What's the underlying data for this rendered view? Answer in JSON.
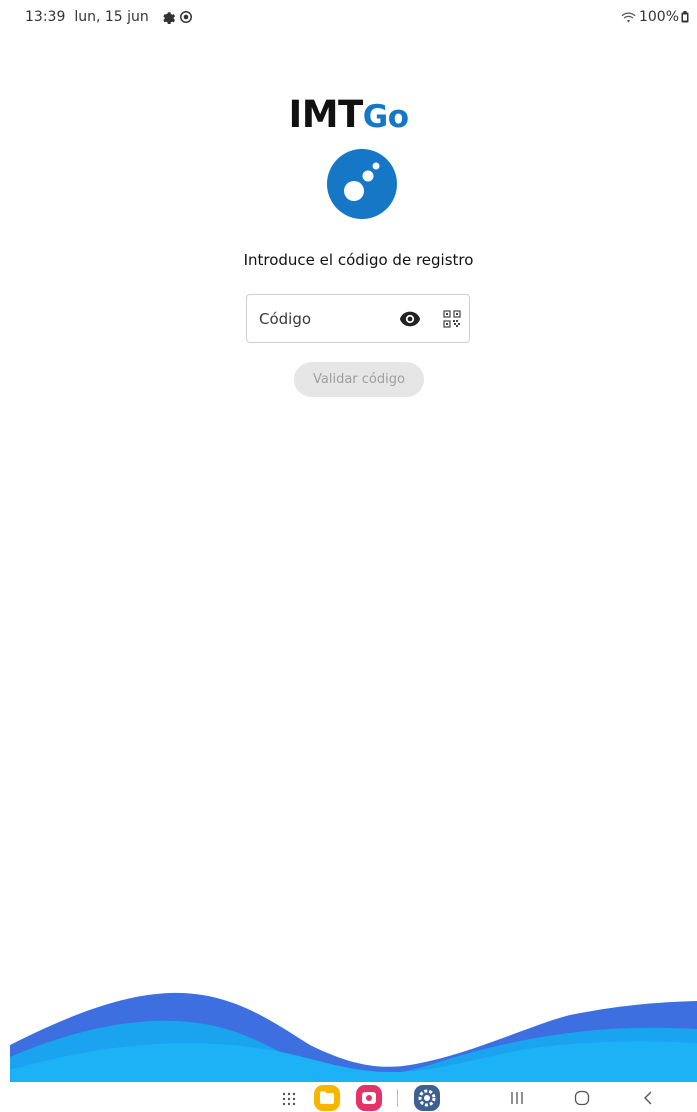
{
  "status_bar": {
    "time": "13:39",
    "date": "lun, 15 jun",
    "battery": "100%",
    "icons": [
      "settings-gear-icon",
      "location-target-icon",
      "wifi-icon",
      "battery-icon"
    ]
  },
  "logo": {
    "part1": "IMT",
    "part2": "Go",
    "colors": {
      "dark": "#111111",
      "brand_blue": "#1577c6"
    }
  },
  "instruction": "Introduce el código de registro",
  "code_input": {
    "value": "",
    "placeholder": "Código",
    "icons": [
      "eye-icon",
      "qr-code-icon"
    ]
  },
  "validate_button": {
    "label": "Validar código",
    "enabled": false
  },
  "wave_colors": [
    "#3d6fe0",
    "#1aa3ef",
    "#1cb2f5"
  ],
  "nav_bar": {
    "icons": [
      "apps-grid-icon",
      "files-app-icon",
      "screen-recorder-app-icon",
      "settings-app-icon",
      "recents-icon",
      "home-icon",
      "back-icon"
    ]
  }
}
